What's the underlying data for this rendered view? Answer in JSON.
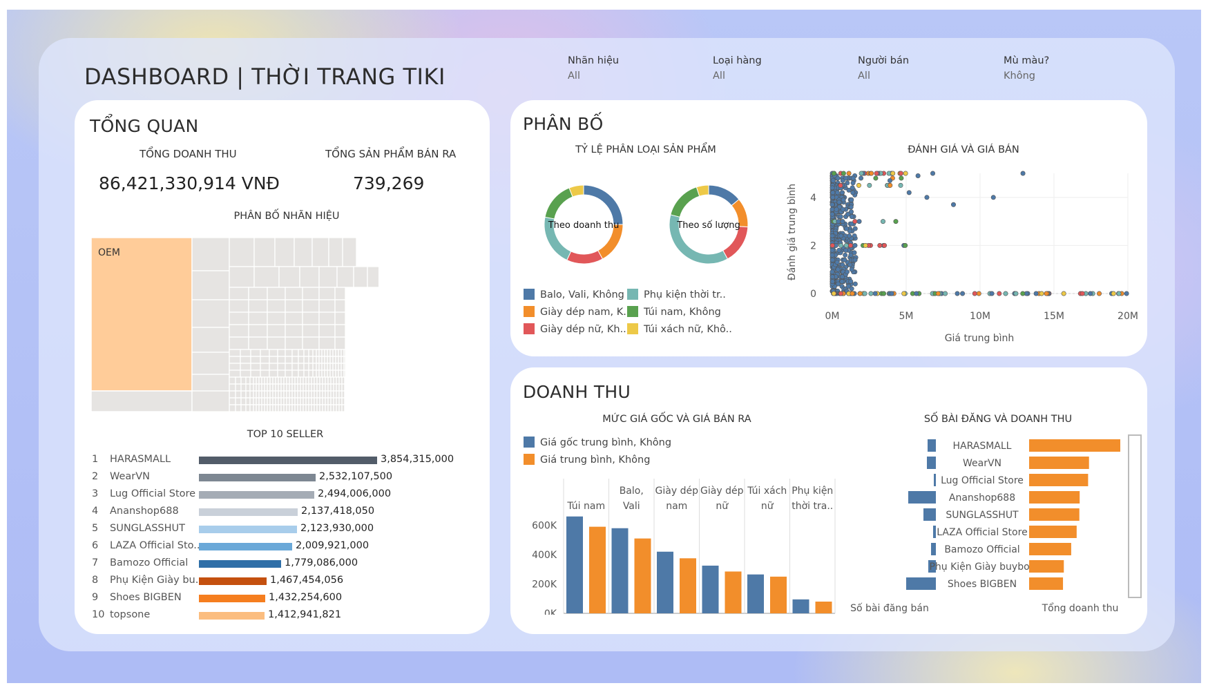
{
  "header": {
    "title": "DASHBOARD | THỜI TRANG TIKI"
  },
  "filters": [
    {
      "label": "Nhãn hiệu",
      "value": "All"
    },
    {
      "label": "Loại hàng",
      "value": "All"
    },
    {
      "label": "Người bán",
      "value": "All"
    },
    {
      "label": "Mù màu?",
      "value": "Không"
    }
  ],
  "overview": {
    "title": "TỔNG QUAN",
    "revenue_label": "TỔNG DOANH THU",
    "revenue_value": "86,421,330,914 VNĐ",
    "sold_label": "TỔNG SẢN PHẨM BÁN RA",
    "sold_value": "739,269",
    "treemap_title": "PHÂN BỐ NHÃN HIỆU",
    "treemap_top_label": "OEM",
    "top_sellers_title": "TOP 10 SELLER",
    "top_sellers": [
      {
        "rank": "1",
        "name": "HARASMALL",
        "value": 3854315000,
        "label": "3,854,315,000",
        "color": "#525c69"
      },
      {
        "rank": "2",
        "name": "WearVN",
        "value": 2532107500,
        "label": "2,532,107,500",
        "color": "#7d8792"
      },
      {
        "rank": "3",
        "name": "Lug Official Store",
        "value": 2494006000,
        "label": "2,494,006,000",
        "color": "#a5acb5"
      },
      {
        "rank": "4",
        "name": "Ananshop688",
        "value": 2137418050,
        "label": "2,137,418,050",
        "color": "#c9d0d9"
      },
      {
        "rank": "5",
        "name": "SUNGLASSHUT",
        "value": 2123930000,
        "label": "2,123,930,000",
        "color": "#a8cdeb"
      },
      {
        "rank": "6",
        "name": "LAZA Official Sto..",
        "value": 2009921000,
        "label": "2,009,921,000",
        "color": "#6aa8d8"
      },
      {
        "rank": "7",
        "name": "Bamozo Official",
        "value": 1779086000,
        "label": "1,779,086,000",
        "color": "#2f6fa8"
      },
      {
        "rank": "8",
        "name": "Phụ Kiện Giày bu..",
        "value": 1467454056,
        "label": "1,467,454,056",
        "color": "#c4500f"
      },
      {
        "rank": "9",
        "name": "Shoes BIGBEN",
        "value": 1432254600,
        "label": "1,432,254,600",
        "color": "#f57e1f"
      },
      {
        "rank": "10",
        "name": "topsone",
        "value": 1412941821,
        "label": "1,412,941,821",
        "color": "#fbbd7f"
      }
    ]
  },
  "distribution": {
    "title": "PHÂN BỐ",
    "donut_title": "TỶ LỆ PHÂN LOẠI SẢN PHẨM",
    "donut1_label": "Theo doanh thu",
    "donut2_label": "Theo số lượng",
    "categories": [
      {
        "name": "Balo, Vali, Không",
        "color": "#4e79a7"
      },
      {
        "name": "Giày dép nam, K..",
        "color": "#f28e2b"
      },
      {
        "name": "Giày dép nữ, Kh..",
        "color": "#e15759"
      },
      {
        "name": "Phụ kiện thời tr..",
        "color": "#76b7b2"
      },
      {
        "name": "Túi nam, Không",
        "color": "#59a14f"
      },
      {
        "name": "Túi xách nữ, Khô..",
        "color": "#edc948"
      }
    ],
    "donut1_shares": [
      0.25,
      0.17,
      0.15,
      0.21,
      0.16,
      0.06
    ],
    "donut2_shares": [
      0.14,
      0.12,
      0.16,
      0.37,
      0.16,
      0.05
    ],
    "scatter_title": "ĐÁNH GIÁ VÀ GIÁ BÁN",
    "scatter_xlabel": "Giá trung bình",
    "scatter_ylabel": "Đánh giá trung bình",
    "scatter_xticks": [
      "0M",
      "5M",
      "10M",
      "15M",
      "20M"
    ],
    "scatter_yticks": [
      "0",
      "2",
      "4"
    ]
  },
  "revenue": {
    "title": "DOANH THU",
    "price_chart_title": "MỨC GIÁ GỐC VÀ GIÁ BÁN RA",
    "legend": [
      {
        "name": "Giá gốc trung bình, Không",
        "color": "#4e79a7"
      },
      {
        "name": "Giá trung bình, Không",
        "color": "#f28e2b"
      }
    ],
    "yticks": [
      "600K",
      "400K",
      "200K",
      "0K"
    ],
    "price_groups": [
      {
        "line1": "Túi nam",
        "line2": "",
        "original": 660000,
        "sale": 590000
      },
      {
        "line1": "Balo,",
        "line2": "Vali",
        "original": 580000,
        "sale": 510000
      },
      {
        "line1": "Giày dép",
        "line2": "nam",
        "original": 420000,
        "sale": 375000
      },
      {
        "line1": "Giày dép",
        "line2": "nữ",
        "original": 325000,
        "sale": 285000
      },
      {
        "line1": "Túi xách",
        "line2": "nữ",
        "original": 265000,
        "sale": 250000
      },
      {
        "line1": "Phụ kiện",
        "line2": "thời tra..",
        "original": 95000,
        "sale": 80000
      }
    ],
    "posts_chart_title": "SỐ BÀI ĐĂNG VÀ DOANH THU",
    "posts_xlabel": "Số bài đăng bán",
    "revenue_xlabel": "Tổng doanh thu",
    "sellers": [
      {
        "name": "HARASMALL",
        "posts": 12,
        "revenue": 3854315000
      },
      {
        "name": "WearVN",
        "posts": 13,
        "revenue": 2532107500
      },
      {
        "name": "Lug Official Store",
        "posts": 3,
        "revenue": 2494006000
      },
      {
        "name": "Ananshop688",
        "posts": 40,
        "revenue": 2137418050
      },
      {
        "name": "SUNGLASSHUT",
        "posts": 18,
        "revenue": 2123930000
      },
      {
        "name": "LAZA Official Store",
        "posts": 4,
        "revenue": 2009921000
      },
      {
        "name": "Bamozo Official",
        "posts": 7,
        "revenue": 1779086000
      },
      {
        "name": "Phụ Kiện Giày buybox",
        "posts": 11,
        "revenue": 1467454056
      },
      {
        "name": "Shoes BIGBEN",
        "posts": 43,
        "revenue": 1432254600
      }
    ]
  },
  "colors": {
    "blue": "#4e79a7",
    "orange": "#f28e2b",
    "oem": "#ffcc99",
    "treemap": "#e6e4e2"
  }
}
